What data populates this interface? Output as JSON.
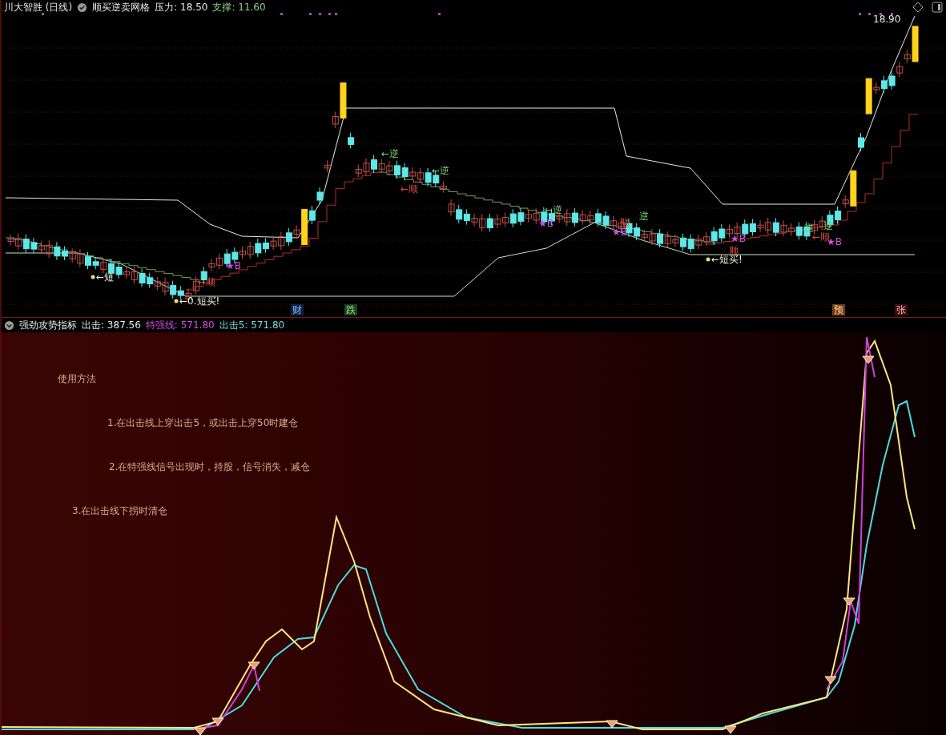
{
  "main_panel": {
    "title": "川大智胜 (日线)",
    "indicator": "顺买逆卖网格",
    "readings": [
      {
        "text": "压力: 18.50",
        "kind": "resistance"
      },
      {
        "text": "支撑: 11.60",
        "kind": "support"
      }
    ],
    "signals": [
      {
        "text": "←短",
        "kind": "short"
      },
      {
        "text": "←0.短买!",
        "kind": "short"
      },
      {
        "text": "←顺",
        "kind": "buy"
      },
      {
        "text": "★B",
        "kind": "star"
      },
      {
        "text": "←逆",
        "kind": "sell"
      },
      {
        "text": "←顺",
        "kind": "buy"
      },
      {
        "text": "←逆",
        "kind": "sell"
      },
      {
        "text": "←逆",
        "kind": "sell"
      },
      {
        "text": "★B",
        "kind": "star"
      },
      {
        "text": "顺",
        "kind": "buy"
      },
      {
        "text": "★B",
        "kind": "star"
      },
      {
        "text": "逆",
        "kind": "sell"
      },
      {
        "text": "★B",
        "kind": "star"
      },
      {
        "text": "顺",
        "kind": "buy"
      },
      {
        "text": "←短买!",
        "kind": "short"
      },
      {
        "text": "逆",
        "kind": "sell"
      },
      {
        "text": "←顺",
        "kind": "buy"
      },
      {
        "text": "逆",
        "kind": "sell"
      },
      {
        "text": "★B",
        "kind": "star"
      },
      {
        "text": "18.90",
        "kind": "price"
      }
    ],
    "markers": [
      {
        "text": "财",
        "kind": "wealth"
      },
      {
        "text": "跌",
        "kind": "fall"
      },
      {
        "text": "预",
        "kind": "warn"
      },
      {
        "text": "张",
        "kind": "rise"
      }
    ]
  },
  "sub_panel": {
    "title": "强劲攻势指标",
    "readings": [
      {
        "text": "出击: 387.56",
        "kind": "strike"
      },
      {
        "text": "特强线: 571.80",
        "kind": "strong"
      },
      {
        "text": "出击5: 571.80",
        "kind": "strike5"
      }
    ],
    "notes": {
      "heading": "使用方法",
      "items": [
        "1.在出击线上穿出击5，或出击上穿50时建仓",
        "2.在特强线信号出现时，持股，信号消失，减仓",
        "3.在出击线下拐时清仓"
      ]
    }
  }
}
